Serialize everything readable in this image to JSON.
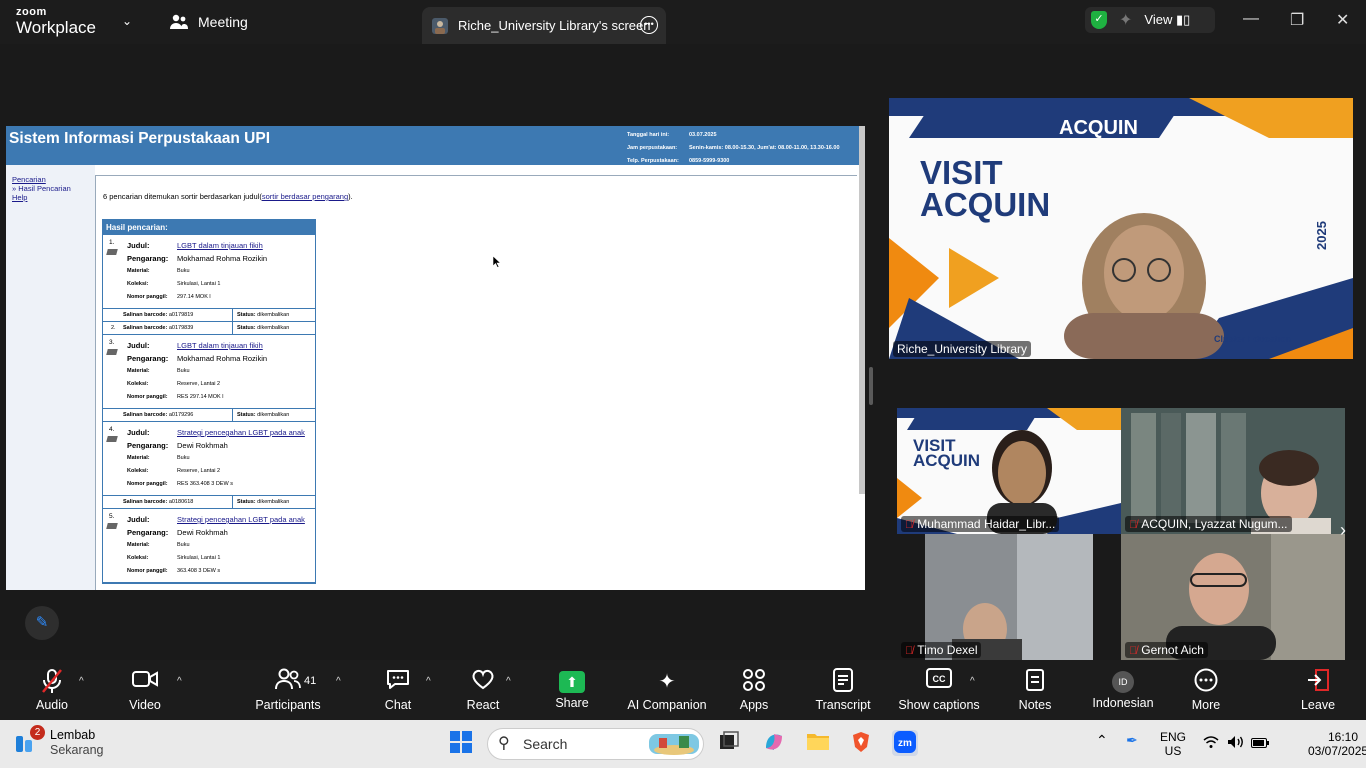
{
  "topbar": {
    "brand_line1": "zoom",
    "brand_line2": "Workplace",
    "meeting_label": "Meeting",
    "screen_tab_label": "Riche_University Library's screen",
    "view_label": "View"
  },
  "shared_screen": {
    "site_title": "Sistem Informasi Perpustakaan UPI",
    "info": [
      {
        "key": "Tanggal hari ini:",
        "value": "03.07.2025"
      },
      {
        "key": "Jam perpustakaan:",
        "value": "Senin-kamis: 08.00-15.30, Jum'at: 08.00-11.00, 13.30-16.00"
      },
      {
        "key": "Telp. Perpustakaan:",
        "value": "0859-5999-9300"
      }
    ],
    "left_nav": {
      "search": "Pencarian",
      "results": "» Hasil Pencarian",
      "help": "Help"
    },
    "summary_prefix": "6 pencarian ditemukan sortir berdasarkan judul(",
    "summary_link": "sortir berdasar pengarang",
    "summary_suffix": ").",
    "results_header": "Hasil pencarian:",
    "labels": {
      "judul": "Judul:",
      "pengarang": "Pengarang:",
      "material": "Material:",
      "koleksi": "Koleksi:",
      "nomor": "Nomor panggil:",
      "barcode": "Salinan barcode:",
      "status": "Status:"
    },
    "records": [
      {
        "num": "1.",
        "judul": "LGBT dalam tinjauan fikih",
        "pengarang": "Mokhamad Rohma Rozikin",
        "material": "Buku",
        "koleksi": "Sirkulasi, Lantai 1",
        "nomor": "297.14 MOK l",
        "barcode": "a0179819",
        "status": "dikembalikan"
      },
      {
        "num": "2.",
        "barcode": "a0179839",
        "status": "dikembalikan"
      },
      {
        "num": "3.",
        "judul": "LGBT dalam tinjauan fikih",
        "pengarang": "Mokhamad Rohma Rozikin",
        "material": "Buku",
        "koleksi": "Reserve, Lantai 2",
        "nomor": "RES 297.14 MOK l",
        "barcode": "a0179296",
        "status": "dikembalikan"
      },
      {
        "num": "4.",
        "judul": "Strategi pencegahan LGBT pada anak",
        "pengarang": "Dewi Rokhmah",
        "material": "Buku",
        "koleksi": "Reserve, Lantai 2",
        "nomor": "RES 363.408 3 DEW s",
        "barcode": "a0180618",
        "status": "dikembalikan"
      },
      {
        "num": "5.",
        "judul": "Strategi pencegahan LGBT pada anak",
        "pengarang": "Dewi Rokhmah",
        "material": "Buku",
        "koleksi": "Sirkulasi, Lantai 1",
        "nomor": "363.408 3 DEW s"
      }
    ]
  },
  "participants": {
    "main": {
      "name": "Riche_University Library",
      "poster_title_1": "VISIT",
      "poster_title_2": "ACQUIN",
      "poster_brand": "ACQUIN",
      "poster_year": "2025",
      "poster_footer": "Cluster Education"
    },
    "tiles": [
      {
        "name": "Muhammad Haidar_Libr...",
        "muted": true
      },
      {
        "name": "ACQUIN, Lyazzat Nugum...",
        "muted": true
      },
      {
        "name": "Timo Dexel",
        "muted": true
      },
      {
        "name": "Gernot Aich",
        "muted": true
      }
    ]
  },
  "toolbar": {
    "audio": "Audio",
    "video": "Video",
    "participants": "Participants",
    "participants_count": "41",
    "chat": "Chat",
    "react": "React",
    "share": "Share",
    "ai_companion": "AI Companion",
    "apps": "Apps",
    "transcript": "Transcript",
    "captions": "Show captions",
    "notes": "Notes",
    "language": "Indonesian",
    "language_badge": "ID",
    "more": "More",
    "leave": "Leave"
  },
  "taskbar": {
    "weather_title": "Lembab",
    "weather_sub": "Sekarang",
    "weather_badge": "2",
    "search_placeholder": "Search",
    "lang_line1": "ENG",
    "lang_line2": "US",
    "time": "16:10",
    "date": "03/07/2025"
  },
  "colors": {
    "accent_blue": "#2d8cff",
    "share_green": "#1db954",
    "mute_red": "#e02828",
    "site_blue": "#3d79b2"
  }
}
